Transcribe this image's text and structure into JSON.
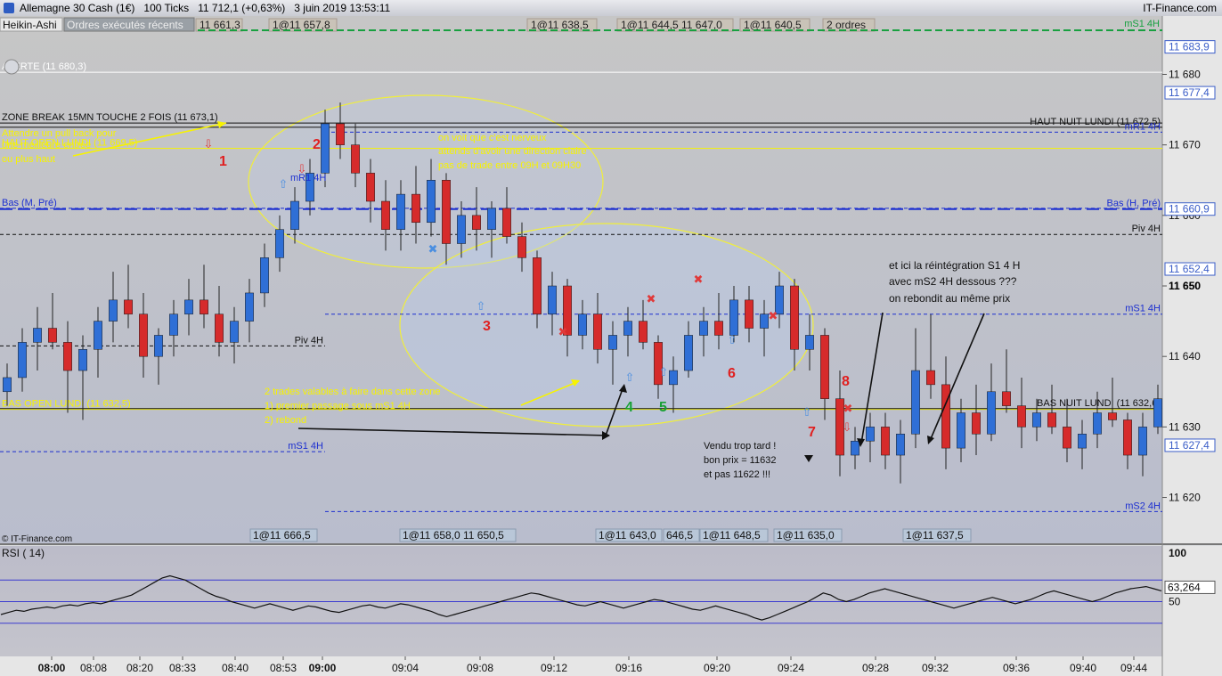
{
  "window": {
    "title": "Allemagne 30 Cash (1€)   100 Ticks   11 712,1 (+0,63%)   3 juin 2019 13:53:11",
    "site": "IT-Finance.com"
  },
  "toolbar": {
    "chart_type": "Heikin-Ashi",
    "orders_tab": "Ordres exécutés récents",
    "orders_count": "2 ordres"
  },
  "colors": {
    "up": "#2f6fd6",
    "down": "#d62b2b",
    "annotation": "#f7f300",
    "ma_blue": "#1c2fd0"
  },
  "chart_data": [
    {
      "type": "candlestick",
      "style": "Heikin-Ashi",
      "ylim": [
        11613.5,
        11686.0
      ],
      "y_ticks": [
        "11 620",
        "11 630",
        "11 640",
        "11 650",
        "11 660",
        "11 670",
        "11 680"
      ],
      "y_tick_values": [
        11620,
        11630,
        11640,
        11650,
        11660,
        11670,
        11680
      ],
      "x_ticks": [
        "08:00",
        "08:08",
        "08:20",
        "08:33",
        "08:40",
        "08:53",
        "09:00",
        "09:04",
        "09:08",
        "09:12",
        "09:16",
        "09:20",
        "09:24",
        "09:28",
        "09:32",
        "09:36",
        "09:40",
        "09:44"
      ],
      "price_tags": [
        {
          "label": "11 683,9",
          "value": 11683.9,
          "color": "#3b5ec8"
        },
        {
          "label": "11 677,4",
          "value": 11677.4,
          "color": "#3b5ec8"
        },
        {
          "label": "11 660,9",
          "value": 11660.9,
          "color": "#3b5ec8"
        },
        {
          "label": "11 652,4",
          "value": 11652.4,
          "color": "#3b5ec8"
        },
        {
          "label": "11 650",
          "value": 11650,
          "color": "#000000"
        },
        {
          "label": "11 627,4",
          "value": 11627.4,
          "color": "#3b5ec8"
        }
      ],
      "levels": [
        {
          "value": 11680.3,
          "label": "ALERTE (11 680,3)",
          "style": "solid",
          "color": "#ffffff",
          "label_side": "left"
        },
        {
          "value": 11673.1,
          "label": "ZONE BREAK 15MN TOUCHE 2 FOIS (11 673,1)",
          "style": "solid",
          "color": "#111111",
          "label_side": "left"
        },
        {
          "value": 11672.5,
          "label": "HAUT NUIT LUNDI (11 672,5)",
          "style": "solid",
          "color": "#111111",
          "label_side": "right"
        },
        {
          "value": 11671.8,
          "label": "mR1 4H",
          "style": "dash",
          "color": "#1c2fd0",
          "label_side": "right"
        },
        {
          "value": 11669.5,
          "label": "HAUT OPEN LUNDI (11 669,5)",
          "style": "solid",
          "color": "#f7f300",
          "label_side": "left"
        },
        {
          "value": 11661.0,
          "label": "Bas (M, Pré)",
          "style": "dash",
          "color": "#1c2fd0",
          "label_side": "left"
        },
        {
          "value": 11660.9,
          "label": "Bas (H, Pré)",
          "style": "longdash",
          "color": "#1c2fd0",
          "label_side": "right"
        },
        {
          "value": 11657.3,
          "label": "Piv 4H",
          "style": "dash",
          "color": "#111111",
          "label_side": "right"
        },
        {
          "value": 11646.0,
          "label": "mS1 4H",
          "style": "dash",
          "color": "#1c2fd0",
          "label_side": "right"
        },
        {
          "value": 11641.5,
          "label": "Piv 4H",
          "style": "dash",
          "color": "#111111",
          "label_side": "mid"
        },
        {
          "value": 11632.5,
          "label": "BAS OPEN LUNDI (11 632,5)",
          "style": "solid",
          "color": "#f7f300",
          "label_side": "left"
        },
        {
          "value": 11632.6,
          "label": "BAS NUIT LUNDI (11 632,6)",
          "style": "solid",
          "color": "#111111",
          "label_side": "right"
        },
        {
          "value": 11626.5,
          "label": "mS1 4H",
          "style": "dash",
          "color": "#1c2fd0",
          "label_side": "mid"
        },
        {
          "value": 11618.0,
          "label": "mS2 4H",
          "style": "dash",
          "color": "#1c2fd0",
          "label_side": "right"
        }
      ],
      "candles": [
        [
          11635,
          11639,
          11633,
          11637
        ],
        [
          11637,
          11644,
          11635,
          11642
        ],
        [
          11642,
          11647,
          11638,
          11644
        ],
        [
          11644,
          11649,
          11641,
          11642
        ],
        [
          11642,
          11645,
          11632,
          11638
        ],
        [
          11638,
          11643,
          11631,
          11641
        ],
        [
          11641,
          11647,
          11637,
          11645
        ],
        [
          11645,
          11652,
          11642,
          11648
        ],
        [
          11648,
          11653,
          11644,
          11646
        ],
        [
          11646,
          11649,
          11637,
          11640
        ],
        [
          11640,
          11644,
          11636,
          11643
        ],
        [
          11643,
          11648,
          11640,
          11646
        ],
        [
          11646,
          11651,
          11643,
          11648
        ],
        [
          11648,
          11653,
          11644,
          11646
        ],
        [
          11646,
          11650,
          11640,
          11642
        ],
        [
          11642,
          11647,
          11639,
          11645
        ],
        [
          11645,
          11651,
          11642,
          11649
        ],
        [
          11649,
          11656,
          11647,
          11654
        ],
        [
          11654,
          11660,
          11652,
          11658
        ],
        [
          11658,
          11664,
          11656,
          11662
        ],
        [
          11662,
          11668,
          11660,
          11666
        ],
        [
          11666,
          11675,
          11664,
          11673
        ],
        [
          11673,
          11676,
          11668,
          11670
        ],
        [
          11670,
          11673,
          11664,
          11666
        ],
        [
          11666,
          11668,
          11659,
          11662
        ],
        [
          11662,
          11665,
          11655,
          11658
        ],
        [
          11658,
          11665,
          11655,
          11663
        ],
        [
          11663,
          11667,
          11656,
          11659
        ],
        [
          11659,
          11668,
          11657,
          11665
        ],
        [
          11665,
          11666,
          11653,
          11656
        ],
        [
          11656,
          11662,
          11654,
          11660
        ],
        [
          11660,
          11664,
          11655,
          11658
        ],
        [
          11658,
          11662,
          11654,
          11661
        ],
        [
          11661,
          11664,
          11656,
          11657
        ],
        [
          11657,
          11659,
          11652,
          11654
        ],
        [
          11654,
          11655,
          11644,
          11646
        ],
        [
          11646,
          11652,
          11643,
          11650
        ],
        [
          11650,
          11651,
          11640,
          11643
        ],
        [
          11643,
          11648,
          11641,
          11646
        ],
        [
          11646,
          11649,
          11639,
          11641
        ],
        [
          11641,
          11645,
          11636,
          11643
        ],
        [
          11643,
          11647,
          11640,
          11645
        ],
        [
          11645,
          11648,
          11641,
          11642
        ],
        [
          11642,
          11643,
          11634,
          11636
        ],
        [
          11636,
          11640,
          11632,
          11638
        ],
        [
          11638,
          11645,
          11637,
          11643
        ],
        [
          11643,
          11647,
          11640,
          11645
        ],
        [
          11645,
          11649,
          11641,
          11643
        ],
        [
          11643,
          11650,
          11642,
          11648
        ],
        [
          11648,
          11650,
          11642,
          11644
        ],
        [
          11644,
          11648,
          11640,
          11646
        ],
        [
          11646,
          11652,
          11644,
          11650
        ],
        [
          11650,
          11651,
          11638,
          11641
        ],
        [
          11641,
          11646,
          11638,
          11643
        ],
        [
          11643,
          11644,
          11631,
          11634
        ],
        [
          11634,
          11638,
          11623,
          11626
        ],
        [
          11626,
          11630,
          11624,
          11628
        ],
        [
          11628,
          11632,
          11625,
          11630
        ],
        [
          11630,
          11632,
          11624,
          11626
        ],
        [
          11626,
          11631,
          11622,
          11629
        ],
        [
          11629,
          11644,
          11627,
          11638
        ],
        [
          11638,
          11646,
          11634,
          11636
        ],
        [
          11636,
          11640,
          11624,
          11627
        ],
        [
          11627,
          11634,
          11625,
          11632
        ],
        [
          11632,
          11636,
          11626,
          11629
        ],
        [
          11629,
          11639,
          11628,
          11635
        ],
        [
          11635,
          11641,
          11632,
          11633
        ],
        [
          11633,
          11637,
          11627,
          11630
        ],
        [
          11630,
          11634,
          11628,
          11632
        ],
        [
          11632,
          11636,
          11629,
          11630
        ],
        [
          11630,
          11634,
          11625,
          11627
        ],
        [
          11627,
          11631,
          11624,
          11629
        ],
        [
          11629,
          11635,
          11627,
          11632
        ],
        [
          11632,
          11637,
          11630,
          11631
        ],
        [
          11631,
          11632,
          11624,
          11626
        ],
        [
          11626,
          11632,
          11623,
          11630
        ],
        [
          11630,
          11636,
          11629,
          11634
        ]
      ],
      "panel": {
        "xlim_count": 77
      }
    },
    {
      "type": "line",
      "title": "RSI ( 14)",
      "y_ticks": [
        "100",
        "50"
      ],
      "ylim": [
        0,
        100
      ],
      "levels": [
        70,
        50,
        30
      ],
      "current_label": "63,264",
      "current_value": 63.264,
      "values": [
        38,
        40,
        42,
        41,
        43,
        44,
        45,
        44,
        46,
        47,
        46,
        48,
        49,
        48,
        50,
        52,
        54,
        56,
        60,
        64,
        68,
        72,
        74,
        72,
        70,
        66,
        62,
        58,
        55,
        53,
        50,
        48,
        46,
        44,
        46,
        48,
        46,
        44,
        42,
        44,
        46,
        45,
        43,
        41,
        40,
        42,
        44,
        46,
        47,
        45,
        44,
        46,
        48,
        47,
        45,
        43,
        41,
        38,
        36,
        38,
        40,
        42,
        44,
        46,
        48,
        50,
        52,
        54,
        56,
        58,
        57,
        55,
        53,
        51,
        49,
        47,
        46,
        48,
        50,
        48,
        46,
        44,
        46,
        48,
        50,
        52,
        51,
        49,
        47,
        45,
        43,
        42,
        44,
        46,
        44,
        42,
        40,
        38,
        35,
        33,
        35,
        38,
        41,
        44,
        47,
        50,
        54,
        58,
        56,
        52,
        50,
        52,
        55,
        58,
        60,
        62,
        60,
        58,
        56,
        54,
        52,
        50,
        48,
        46,
        44,
        46,
        48,
        50,
        52,
        54,
        52,
        50,
        48,
        50,
        52,
        55,
        58,
        60,
        58,
        56,
        54,
        52,
        50,
        52,
        55,
        58,
        60,
        62,
        63,
        64,
        62,
        60
      ]
    }
  ],
  "annotations": {
    "yellow_top_left": [
      "Attendre un pull back pour",
      "une meilleure entrée",
      "ou plus haut"
    ],
    "yellow_ellipse1": [
      "on voit que c'est nerveux",
      "attends d'avoir une direction claire",
      "pas de trade entre 09H et 09H30"
    ],
    "yellow_bottom": [
      "2 trades valables à faire dans cette zone",
      "1) premier passage sous mS1 4H",
      "2) rebond"
    ],
    "right_note": [
      "et ici la réintégration S1 4 H",
      "avec mS2 4H dessous ???",
      "on rebondit au même prix"
    ],
    "sold_note": [
      "Vendu trop tard !",
      "bon prix = 11632",
      "et pas 11622 !!!"
    ],
    "mid_label": "mR1 4H",
    "numbers_red": [
      "1",
      "2",
      "3",
      "6",
      "7",
      "8"
    ],
    "numbers_green": [
      "4",
      "5"
    ],
    "order_tags": [
      "11 661,3",
      "1@11 657,8",
      "1@11 638,5",
      "1@11 644,5 11 647,0",
      "1@11 640,5"
    ],
    "execution_tags": [
      "1@11 666,5",
      "1@11 658,0 11 650,5",
      "1@11 643,0",
      "646,5",
      "1@11 648,5",
      "1@11 635,0",
      "1@11 637,5"
    ],
    "watermark": "© IT-Finance.com",
    "tag_mS1_right": "mS1 4H"
  }
}
